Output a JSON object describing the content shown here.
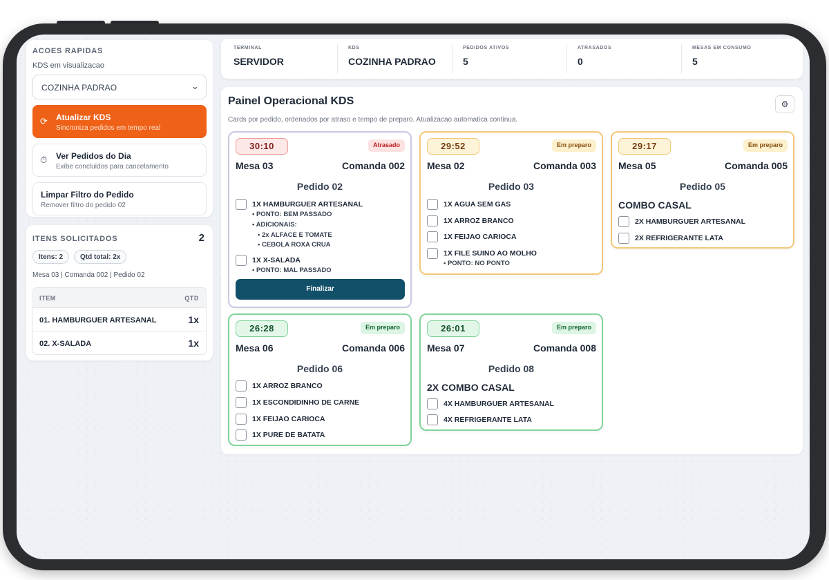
{
  "sidebar": {
    "quick_title": "ACOES RAPIDAS",
    "kds_label": "KDS em visualizacao",
    "kds_selected": "COZINHA PADRAO",
    "actions": [
      {
        "title": "Atualizar KDS",
        "subtitle": "Sincroniza pedidos em tempo real",
        "icon": "refresh-icon"
      },
      {
        "title": "Ver Pedidos do Dia",
        "subtitle": "Exibe concluidos para cancelamento",
        "icon": "history-icon"
      },
      {
        "title": "Limpar Filtro do Pedido",
        "subtitle": "Remover filtro do pedido 02"
      }
    ],
    "items_title": "ITENS SOLICITADOS",
    "items_count": "2",
    "pill_items": "Itens: 2",
    "pill_qty": "Qtd total: 2x",
    "reference": "Mesa 03 | Comanda 002 | Pedido 02",
    "table": {
      "headers": [
        "ITEM",
        "QTD"
      ],
      "rows": [
        {
          "item": "01. HAMBURGUER ARTESANAL",
          "qty": "1x"
        },
        {
          "item": "02. X-SALADA",
          "qty": "1x"
        }
      ]
    }
  },
  "stats": [
    {
      "label": "TERMINAL",
      "value": "SERVIDOR"
    },
    {
      "label": "KDS",
      "value": "COZINHA PADRAO"
    },
    {
      "label": "PEDIDOS ATIVOS",
      "value": "5"
    },
    {
      "label": "ATRASADOS",
      "value": "0"
    },
    {
      "label": "MESAS EM CONSUMO",
      "value": "5"
    }
  ],
  "board": {
    "title": "Painel Operacional KDS",
    "subtitle": "Cards por pedido, ordenados por atraso e tempo de preparo. Atualizacao automatica continua.",
    "settings_icon": "sliders-icon"
  },
  "cards": [
    {
      "timer": "30:10",
      "status": "Atrasado",
      "mesa": "Mesa 03",
      "comanda": "Comanda 002",
      "pedido": "Pedido 02",
      "items": [
        "1X HAMBURGUER ARTESANAL",
        "1X X-SALADA"
      ],
      "notes": [
        "• PONTO: BEM PASSADO",
        "• ADICIONAIS:",
        "• 2x ALFACE E TOMATE",
        "• CEBOLA ROXA CRUA",
        "• PONTO: MAL PASSADO"
      ],
      "finalize": "Finalizar"
    },
    {
      "timer": "29:52",
      "status": "Em preparo",
      "mesa": "Mesa 02",
      "comanda": "Comanda 003",
      "pedido": "Pedido 03",
      "items": [
        "1X AGUA SEM GAS",
        "1X ARROZ BRANCO",
        "1X FEIJAO CARIOCA",
        "1X FILE SUINO AO MOLHO"
      ],
      "notes": [
        "• PONTO: NO PONTO"
      ]
    },
    {
      "timer": "29:17",
      "status": "Em preparo",
      "mesa": "Mesa 05",
      "comanda": "Comanda 005",
      "pedido": "Pedido 05",
      "combo": "COMBO CASAL",
      "items": [
        "2X HAMBURGUER ARTESANAL",
        "2X REFRIGERANTE LATA"
      ]
    },
    {
      "timer": "26:28",
      "status": "Em preparo",
      "mesa": "Mesa 06",
      "comanda": "Comanda 006",
      "pedido": "Pedido 06",
      "items": [
        "1X ARROZ BRANCO",
        "1X ESCONDIDINHO DE CARNE",
        "1X FEIJAO CARIOCA",
        "1X PURE DE BATATA"
      ]
    },
    {
      "timer": "26:01",
      "status": "Em preparo",
      "mesa": "Mesa 07",
      "comanda": "Comanda 008",
      "pedido": "Pedido 08",
      "combo": "2X COMBO CASAL",
      "items": [
        "4X HAMBURGUER ARTESANAL",
        "4X REFRIGERANTE LATA"
      ]
    }
  ],
  "colors": {
    "accent": "#ee6117",
    "finalize": "#12506a",
    "late_border": "#c7cbe0",
    "prep_border": "#f1c877",
    "ready_border": "#7fd49a"
  }
}
